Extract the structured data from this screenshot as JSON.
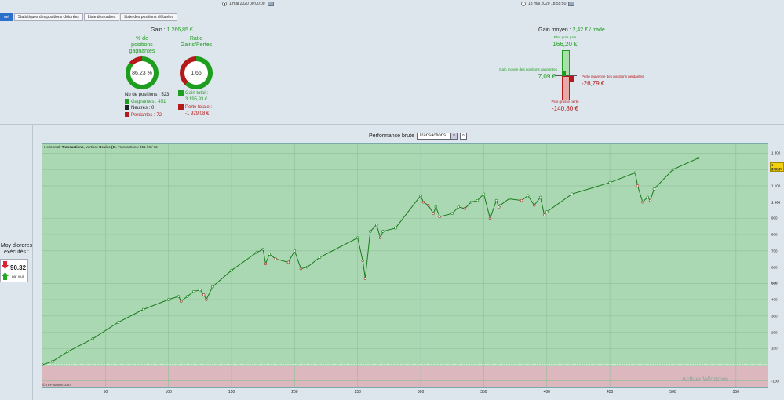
{
  "topbar": {
    "start_date": "1 mai 2020 00:00:00",
    "end_date": "18 mai 2020 18:55:50"
  },
  "tabs": [
    {
      "label": "uel",
      "active": true
    },
    {
      "label": "Statistiques des positions clôturées",
      "active": false
    },
    {
      "label": "Liste des ordres",
      "active": false
    },
    {
      "label": "Liste des positions clôturées",
      "active": false
    }
  ],
  "gain": {
    "label": "Gain : ",
    "value": "1 266,85 €"
  },
  "winrate": {
    "title_line1": "% de",
    "title_line2": "positions",
    "title_line3": "gagnantes",
    "value": "86,23 %",
    "fraction": 0.8623
  },
  "ratio": {
    "title_line1": "Ratio",
    "title_line2": "Gains/Pertes",
    "value": "1,66",
    "fraction": 0.62
  },
  "positions": {
    "total_label": "Nb de positions : ",
    "total": "523",
    "winners_label": "Gagnantes : ",
    "winners": "451",
    "neutral_label": "Neutres : ",
    "neutral": "0",
    "losers_label": "Perdantes : ",
    "losers": "72"
  },
  "totals": {
    "gain_label": "Gain total :",
    "gain_value": "3 195,93 €",
    "loss_label": "Perte totale :",
    "loss_value": "-1 929,08 €"
  },
  "avg": {
    "label": "Gain moyen : ",
    "value": "2,42 € / trade",
    "max_gain_label": "Plus gros gain",
    "max_gain": "166,20 €",
    "avg_gain_label": "Gain moyen des positions gagnantes",
    "avg_gain": "7,09 €",
    "avg_loss_label": "Perte moyenne des positions perdantes",
    "avg_loss": "-26,79 €",
    "max_loss_label": "Plus grosse perte",
    "max_loss": "-140,80 €"
  },
  "perf": {
    "title": "Performance brute",
    "select": "Transactions",
    "select_arrow": "▾",
    "zoom": "⌕"
  },
  "left": {
    "line1": "Moy d'ordres",
    "line2": "exécutés :",
    "value": "90.32",
    "unit": "par jour"
  },
  "chart_header": {
    "h": "Horizontal: ",
    "h_val": "Transactions",
    "v": ", Vertical: ",
    "v_val": "Devise (€)",
    "t": ", Transactions: ",
    "t_val": "451 / 0 / 72"
  },
  "copyright": "© IT-Finance.com",
  "watermark": "Activer Windows",
  "colors": {
    "green": "#1e9e1e",
    "red": "#b51a1a",
    "chart_bg": "#a9d8b3",
    "chart_neg_bg": "#dcb7bd"
  },
  "chart_data": {
    "type": "line",
    "xlim": [
      0,
      575
    ],
    "ylim": [
      -140,
      1360
    ],
    "x_ticks": [
      "50",
      "100",
      "150",
      "200",
      "250",
      "300",
      "350",
      "400",
      "450",
      "500",
      "550"
    ],
    "y_ticks": [
      "1 300",
      "1 200",
      "1 100",
      "1 000",
      "900",
      "800",
      "700",
      "600",
      "500",
      "400",
      "300",
      "200",
      "100",
      "-100"
    ],
    "last_value": "1 266,85",
    "x": [
      0,
      8,
      20,
      40,
      60,
      80,
      100,
      108,
      110,
      115,
      120,
      125,
      128,
      130,
      135,
      150,
      170,
      175,
      177,
      180,
      185,
      195,
      200,
      205,
      210,
      220,
      250,
      254,
      256,
      260,
      265,
      268,
      270,
      280,
      300,
      302,
      306,
      310,
      312,
      315,
      325,
      330,
      335,
      340,
      345,
      350,
      355,
      360,
      362,
      363,
      370,
      380,
      385,
      390,
      395,
      398,
      400,
      420,
      450,
      470,
      472,
      476,
      480,
      482,
      485,
      500,
      520
    ],
    "y": [
      0,
      20,
      80,
      160,
      260,
      340,
      400,
      420,
      390,
      420,
      450,
      460,
      430,
      400,
      480,
      580,
      690,
      710,
      620,
      680,
      650,
      630,
      700,
      590,
      600,
      660,
      780,
      640,
      530,
      820,
      860,
      780,
      820,
      840,
      1040,
      1000,
      980,
      930,
      970,
      910,
      930,
      970,
      960,
      1000,
      1010,
      1050,
      900,
      1010,
      970,
      980,
      1020,
      1010,
      1040,
      980,
      1030,
      920,
      940,
      1050,
      1120,
      1180,
      1100,
      1000,
      1030,
      1010,
      1080,
      1200,
      1270
    ]
  }
}
